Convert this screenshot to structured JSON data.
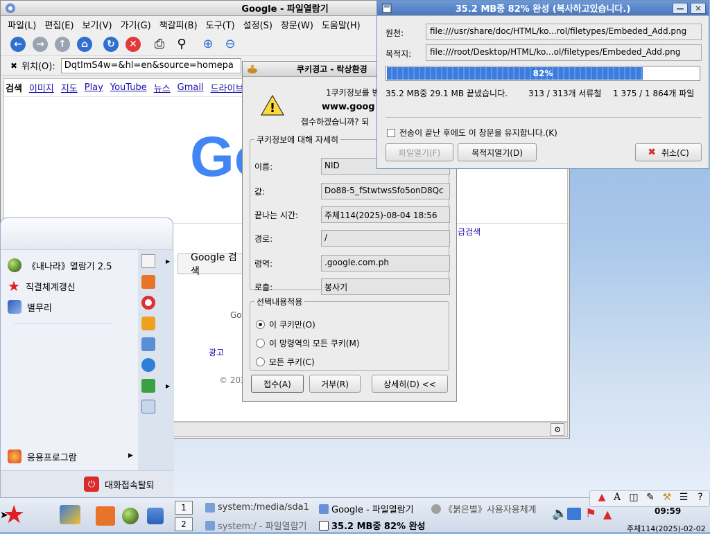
{
  "browser": {
    "title": "Google - 파일열람기",
    "menu": [
      "파일(L)",
      "편집(E)",
      "보기(V)",
      "가기(G)",
      "책갈피(B)",
      "도구(T)",
      "설정(S)",
      "창문(W)",
      "도움말(H)"
    ],
    "location_label": "위치(O):",
    "url": "DqtlmS4w=&hl=en&source=homepa",
    "google_bar": [
      "검색",
      "이미지",
      "지도",
      "Play",
      "YouTube",
      "뉴스",
      "Gmail",
      "드라이브"
    ],
    "logo_text": "Go",
    "search_button": "Google 검색",
    "advanced_search": "급검색",
    "go_text": "Go",
    "ads_link": "광고",
    "copyright": "© 202"
  },
  "cookie_dialog": {
    "title": "쿠키경고 - 락상환경",
    "message_line1": "1쿠키정보를 받",
    "message_line2": "www.goog",
    "message_line3": "접수하겠습니까? 되",
    "details_legend": "쿠키정보에 대해 자세히",
    "fields": [
      {
        "label": "이름:",
        "value": "NID"
      },
      {
        "label": "값:",
        "value": "Do88-5_fStwtwsSfo5onD8Qc"
      },
      {
        "label": "끝나는 시간:",
        "value": "주체114(2025)-08-04 18:56"
      },
      {
        "label": "경로:",
        "value": "/"
      },
      {
        "label": "령역:",
        "value": ".google.com.ph"
      },
      {
        "label": "로출:",
        "value": "봉사기"
      }
    ],
    "apply_legend": "선택내용적용",
    "options": [
      "이 쿠키만(O)",
      "이 망령역의 모든 쿠키(M)",
      "모든 쿠키(C)"
    ],
    "selected_option": 0,
    "buttons": {
      "accept": "접수(A)",
      "reject": "거부(R)",
      "details": "상세히(D) <<"
    }
  },
  "copy_dialog": {
    "title": "35.2 MB중 82% 완성 (복사하고있습니다.)",
    "source_label": "원천:",
    "source": "file:///usr/share/doc/HTML/ko...rol/filetypes/Embeded_Add.png",
    "dest_label": "목적지:",
    "dest": "file:///root/Desktop/HTML/ko...ol/filetypes/Embeded_Add.png",
    "progress_percent": 82,
    "progress_text": "82%",
    "stat_bytes": "35.2 MB중 29.1 MB 끝냈습니다.",
    "stat_dirs": "313 / 313개 서류철",
    "stat_files": "1 375 / 1 864개 파일",
    "keep_open": "전송이 끝난 후에도 이 창문을 유지합니다.(K)",
    "buttons": {
      "open_file": "파일열기(F)",
      "open_dest": "목적지열기(D)",
      "cancel": "취소(C)"
    }
  },
  "start_menu": {
    "items": [
      "《내나라》열람기 2.5",
      "직결체계갱신",
      "별무리"
    ],
    "apps": "응용프로그람",
    "logout": "대화접속탈퇴"
  },
  "taskbar": {
    "desktop_1": "1",
    "desktop_2": "2",
    "tasks": [
      "system:/media/sda1",
      "Google - 파일열람기",
      "《붉은별》사용자용체계",
      "system:/ - 파일열람기",
      "35.2 MB중 82% 완성"
    ],
    "clock": "09:59",
    "date": "주체114(2025)-02-02",
    "ime_letter": "A"
  },
  "colors": {
    "accent_blue": "#4a78c0",
    "progress": "#3d7cdc",
    "google_blue": "#4285f4",
    "google_red": "#ea4335"
  }
}
